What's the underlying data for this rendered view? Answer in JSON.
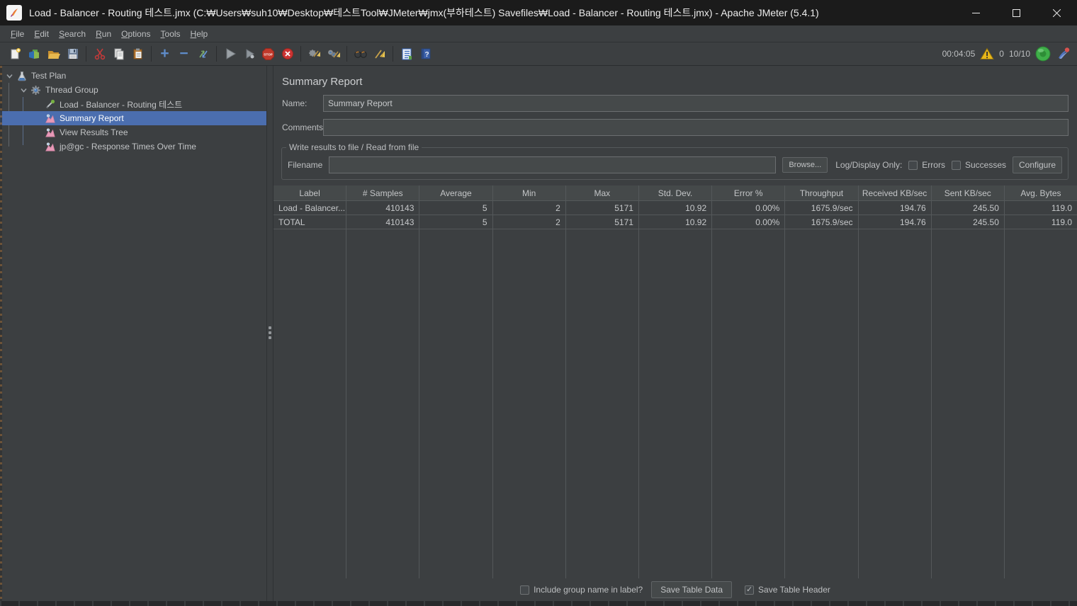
{
  "window": {
    "title": "Load - Balancer - Routing 테스트.jmx (C:₩Users₩suh10₩Desktop₩테스트Tool₩JMeter₩jmx(부하테스트) Savefiles₩Load - Balancer - Routing 테스트.jmx) - Apache JMeter (5.4.1)"
  },
  "menu": [
    "File",
    "Edit",
    "Search",
    "Run",
    "Options",
    "Tools",
    "Help"
  ],
  "toolbar": {
    "icons": [
      "new-file",
      "open-template",
      "open-file",
      "save",
      "cut",
      "copy",
      "paste",
      "expand-all",
      "collapse-all",
      "toggle",
      "start",
      "start-no-pauses",
      "stop",
      "shutdown",
      "clear",
      "clear-all",
      "search",
      "search-reset",
      "function-helper",
      "help"
    ],
    "status": {
      "elapsed": "00:04:05",
      "warning_count": "0",
      "threads": "10/10"
    }
  },
  "tree": {
    "items": [
      {
        "label": "Test Plan",
        "level": 0,
        "icon": "test-plan",
        "expanded": true,
        "selected": false
      },
      {
        "label": "Thread Group",
        "level": 1,
        "icon": "thread-group",
        "expanded": true,
        "selected": false
      },
      {
        "label": "Load - Balancer - Routing 테스트",
        "level": 2,
        "icon": "sampler",
        "selected": false
      },
      {
        "label": "Summary Report",
        "level": 2,
        "icon": "listener",
        "selected": true
      },
      {
        "label": "View Results Tree",
        "level": 2,
        "icon": "listener",
        "selected": false
      },
      {
        "label": "jp@gc - Response Times Over Time",
        "level": 2,
        "icon": "listener",
        "selected": false
      }
    ]
  },
  "panel": {
    "title": "Summary Report",
    "name_label": "Name:",
    "name_value": "Summary Report",
    "comments_label": "Comments:",
    "comments_value": "",
    "group_title": "Write results to file / Read from file",
    "filename_label": "Filename",
    "filename_value": "",
    "browse_label": "Browse...",
    "log_display_label": "Log/Display Only:",
    "errors_label": "Errors",
    "errors_checked": false,
    "successes_label": "Successes",
    "successes_checked": false,
    "configure_label": "Configure"
  },
  "table": {
    "columns": [
      "Label",
      "# Samples",
      "Average",
      "Min",
      "Max",
      "Std. Dev.",
      "Error %",
      "Throughput",
      "Received KB/sec",
      "Sent KB/sec",
      "Avg. Bytes"
    ],
    "rows": [
      [
        "Load - Balancer...",
        "410143",
        "5",
        "2",
        "5171",
        "10.92",
        "0.00%",
        "1675.9/sec",
        "194.76",
        "245.50",
        "119.0"
      ],
      [
        "TOTAL",
        "410143",
        "5",
        "2",
        "5171",
        "10.92",
        "0.00%",
        "1675.9/sec",
        "194.76",
        "245.50",
        "119.0"
      ]
    ]
  },
  "footer": {
    "include_group_label": "Include group name in label?",
    "include_group_checked": false,
    "save_table_data_label": "Save Table Data",
    "save_table_header_label": "Save Table Header",
    "save_table_header_checked": true
  },
  "colors": {
    "selection": "#4b6eaf",
    "running_indicator": "#43a047",
    "warning": "#e8b71a",
    "panel_background": "#3c3f41",
    "titlebar_background": "#1b1b1b"
  }
}
